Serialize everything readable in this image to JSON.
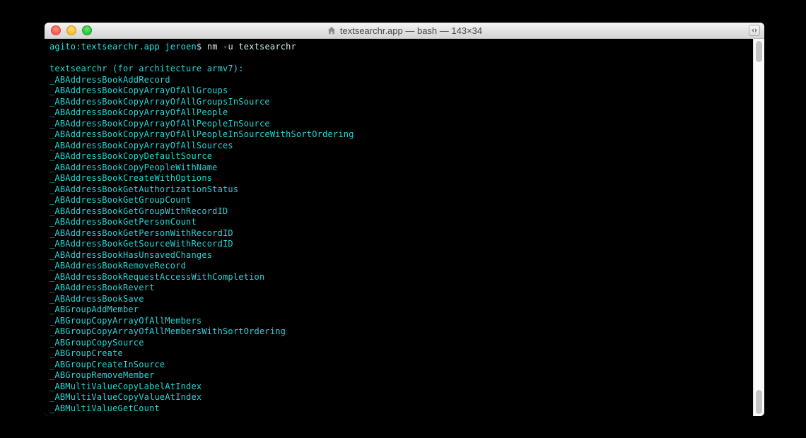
{
  "window": {
    "title": "textsearchr.app — bash — 143×34"
  },
  "prompt": {
    "host": "agito",
    "sep": ":",
    "cwd": "textsearchr.app",
    "user": "jeroen",
    "dollar": "$",
    "command": "nm -u textsearchr"
  },
  "output_header": "textsearchr (for architecture armv7):",
  "symbols": [
    "_ABAddressBookAddRecord",
    "_ABAddressBookCopyArrayOfAllGroups",
    "_ABAddressBookCopyArrayOfAllGroupsInSource",
    "_ABAddressBookCopyArrayOfAllPeople",
    "_ABAddressBookCopyArrayOfAllPeopleInSource",
    "_ABAddressBookCopyArrayOfAllPeopleInSourceWithSortOrdering",
    "_ABAddressBookCopyArrayOfAllSources",
    "_ABAddressBookCopyDefaultSource",
    "_ABAddressBookCopyPeopleWithName",
    "_ABAddressBookCreateWithOptions",
    "_ABAddressBookGetAuthorizationStatus",
    "_ABAddressBookGetGroupCount",
    "_ABAddressBookGetGroupWithRecordID",
    "_ABAddressBookGetPersonCount",
    "_ABAddressBookGetPersonWithRecordID",
    "_ABAddressBookGetSourceWithRecordID",
    "_ABAddressBookHasUnsavedChanges",
    "_ABAddressBookRemoveRecord",
    "_ABAddressBookRequestAccessWithCompletion",
    "_ABAddressBookRevert",
    "_ABAddressBookSave",
    "_ABGroupAddMember",
    "_ABGroupCopyArrayOfAllMembers",
    "_ABGroupCopyArrayOfAllMembersWithSortOrdering",
    "_ABGroupCopySource",
    "_ABGroupCreate",
    "_ABGroupCreateInSource",
    "_ABGroupRemoveMember",
    "_ABMultiValueCopyLabelAtIndex",
    "_ABMultiValueCopyValueAtIndex",
    "_ABMultiValueGetCount"
  ]
}
